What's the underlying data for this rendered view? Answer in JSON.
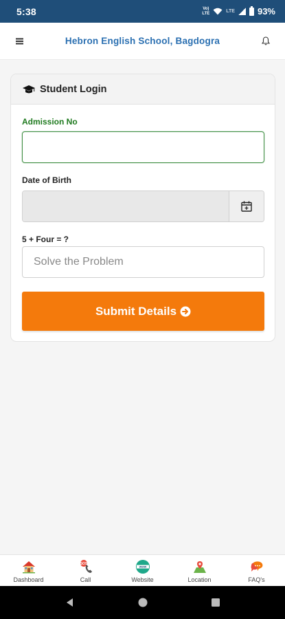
{
  "status_bar": {
    "time": "5:38",
    "volte": "Vo)\nLTE",
    "lte": "LTE",
    "battery": "93%"
  },
  "header": {
    "title": "Hebron English School, Bagdogra",
    "menu_icon": "hamburger-menu-icon",
    "notification_icon": "bell-icon"
  },
  "card": {
    "title": "Student Login",
    "title_icon": "graduation-cap-icon",
    "admission_label": "Admission No",
    "admission_value": "",
    "dob_label": "Date of Birth",
    "dob_value": "",
    "calendar_icon": "calendar-plus-icon",
    "captcha_label": "5 + Four = ?",
    "captcha_placeholder": "Solve the Problem",
    "submit_label": "Submit Details",
    "submit_icon": "arrow-circle-right-icon"
  },
  "bottom_nav": {
    "items": [
      {
        "label": "Dashboard",
        "icon": "house-icon"
      },
      {
        "label": "Call",
        "icon": "phone-icon"
      },
      {
        "label": "Website",
        "icon": "www-globe-icon"
      },
      {
        "label": "Location",
        "icon": "map-pin-icon"
      },
      {
        "label": "FAQ's",
        "icon": "chat-bubble-icon"
      }
    ]
  },
  "colors": {
    "status_bar": "#1f4e79",
    "title": "#2a6fb1",
    "active_label": "#1f7a1f",
    "active_border": "#3e8e41",
    "submit": "#f47a0c"
  }
}
